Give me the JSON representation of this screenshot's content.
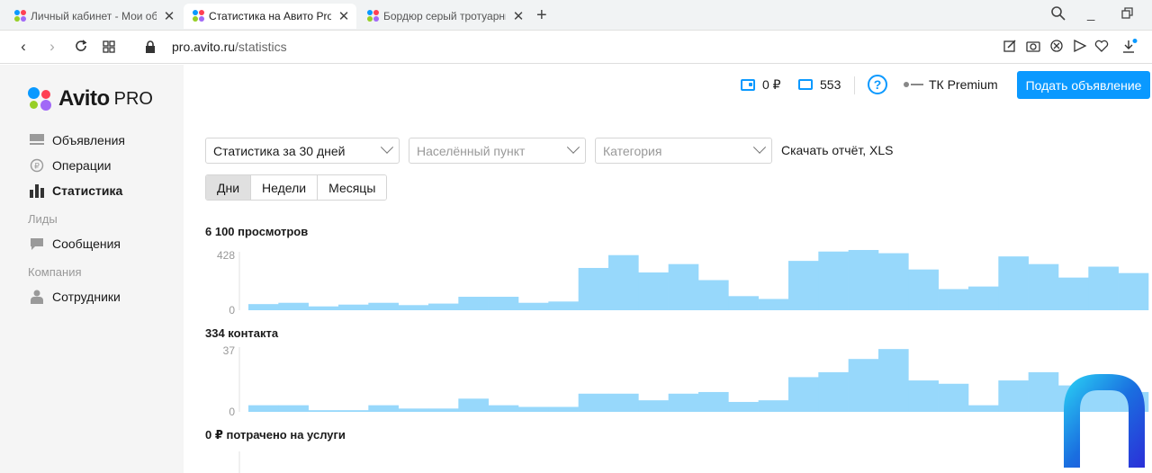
{
  "browser": {
    "tabs": [
      {
        "title": "Личный кабинет - Мои объявления",
        "active": false
      },
      {
        "title": "Статистика на Авито Pro",
        "active": true
      },
      {
        "title": "Бордюр серый тротуарный",
        "active": false
      }
    ],
    "address": {
      "host": "pro.avito.ru",
      "path": "/statistics"
    }
  },
  "sidebar": {
    "brand": "Avito",
    "brand_suffix": "PRO",
    "items": [
      {
        "label": "Объявления",
        "icon": "list-icon"
      },
      {
        "label": "Операции",
        "icon": "operations-icon"
      },
      {
        "label": "Статистика",
        "icon": "bar-chart-icon",
        "active": true
      },
      {
        "section": "Лиды"
      },
      {
        "label": "Сообщения",
        "icon": "message-icon"
      },
      {
        "section": "Компания"
      },
      {
        "label": "Сотрудники",
        "icon": "person-icon"
      }
    ]
  },
  "header": {
    "wallet": "0 ₽",
    "tickets": "553",
    "help": "?",
    "tariff": "ТК Premium",
    "post_button": "Подать объявление"
  },
  "filters": {
    "period_select": "Статистика за 30 дней",
    "location_placeholder": "Населённый пункт",
    "category_placeholder": "Категория",
    "download": "Скачать отчёт, XLS",
    "periods": [
      "Дни",
      "Недели",
      "Месяцы"
    ],
    "active_period": "Дни"
  },
  "colors": {
    "accent": "#0a99ff",
    "bar": "#97d8fb"
  },
  "chart_data": [
    {
      "type": "bar",
      "title": "6 100 просмотров",
      "ylim": [
        0,
        428
      ],
      "yticks": [
        "428",
        "0"
      ],
      "values": [
        48,
        58,
        30,
        44,
        58,
        40,
        52,
        105,
        105,
        58,
        68,
        330,
        430,
        295,
        360,
        235,
        110,
        88,
        385,
        458,
        470,
        445,
        318,
        165,
        185,
        420,
        360,
        255,
        340,
        290
      ]
    },
    {
      "type": "bar",
      "title": "334 контакта",
      "ylim": [
        0,
        37
      ],
      "yticks": [
        "37",
        "0"
      ],
      "values": [
        4,
        4,
        1,
        1,
        4,
        2,
        2,
        8,
        4,
        3,
        3,
        11,
        11,
        7,
        11,
        12,
        6,
        7,
        21,
        24,
        32,
        38,
        19,
        17,
        4,
        19,
        24,
        16,
        16,
        12
      ]
    },
    {
      "type": "bar",
      "title": "0 ₽ потрачено на услуги",
      "values": []
    }
  ]
}
